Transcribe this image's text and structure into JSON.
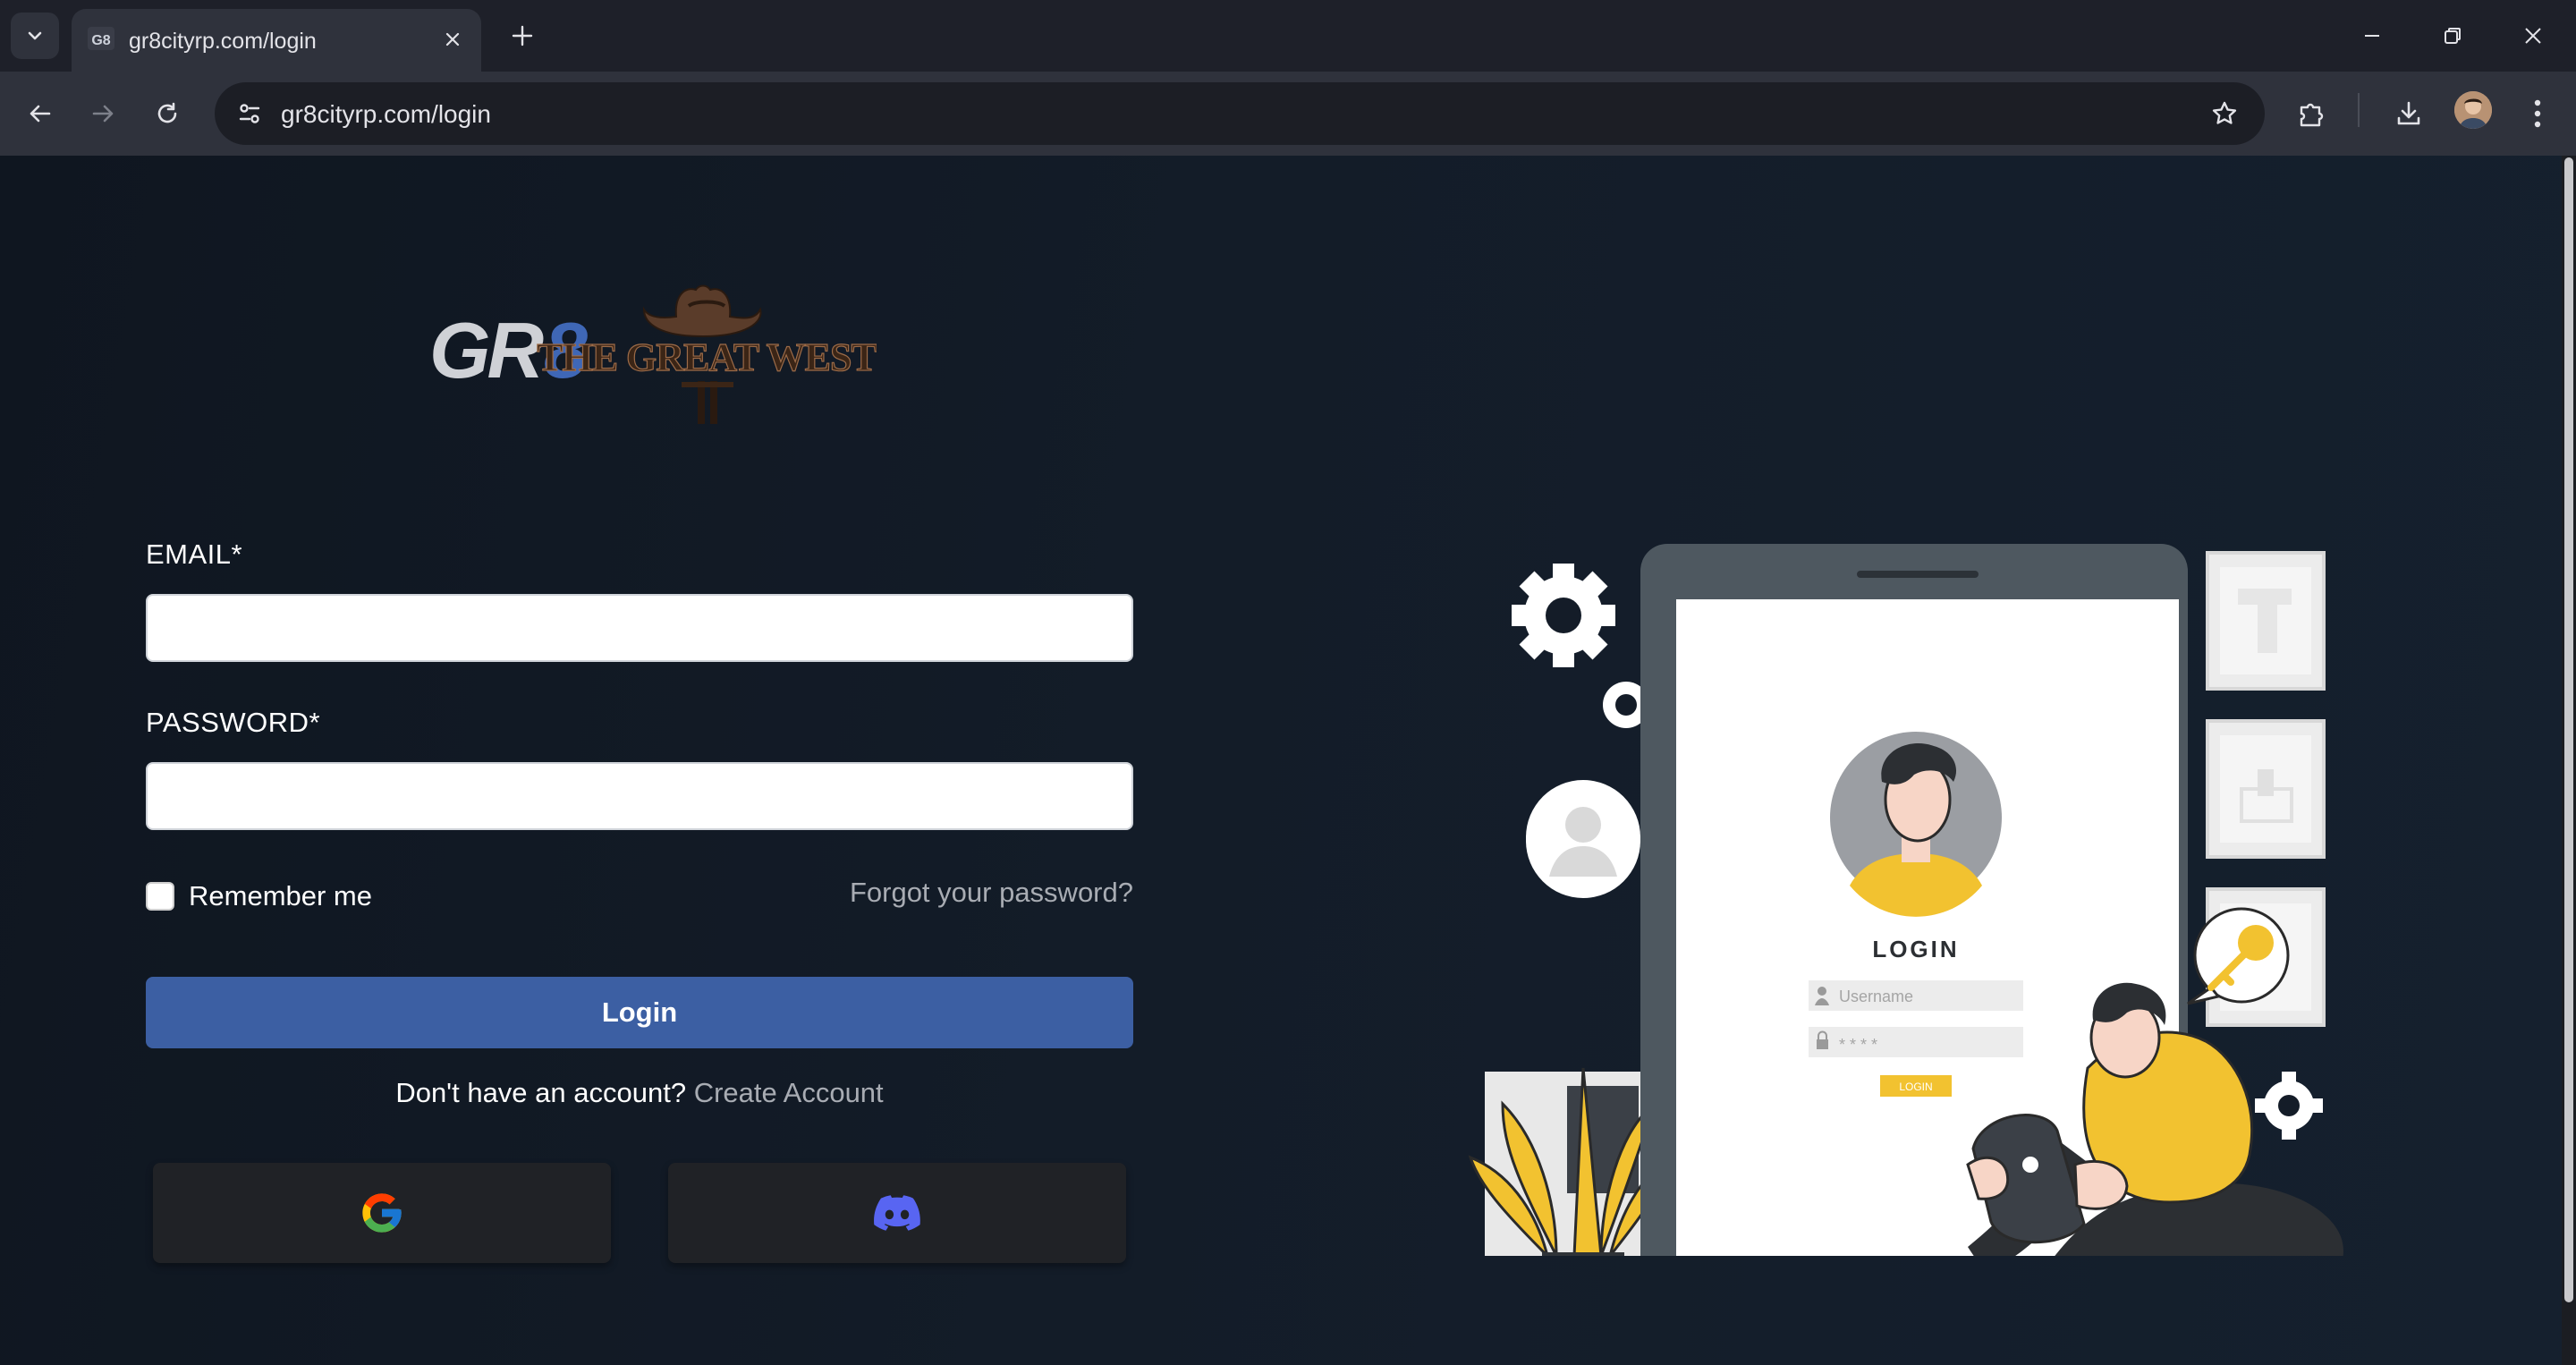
{
  "browser": {
    "tab_title": "gr8cityrp.com/login",
    "url": "gr8cityrp.com/login"
  },
  "logo": {
    "brand_text": "GR8",
    "secondary_text": "THE GREAT WEST"
  },
  "form": {
    "email_label": "EMAIL*",
    "email_value": "",
    "password_label": "PASSWORD*",
    "password_value": "",
    "remember_label": "Remember me",
    "remember_checked": false,
    "forgot_label": "Forgot your password?",
    "login_label": "Login",
    "signup_prompt": "Don't have an account?",
    "signup_link": "Create Account"
  },
  "social": {
    "google_icon": "google-icon",
    "discord_icon": "discord-icon"
  },
  "illustration": {
    "login_title": "LOGIN",
    "username_placeholder": "Username",
    "password_mask": "* * * *",
    "button_label": "LOGIN"
  },
  "colors": {
    "accent": "#3c5fa3",
    "page_bg": "#131c28",
    "illustration_yellow": "#f2c230"
  }
}
